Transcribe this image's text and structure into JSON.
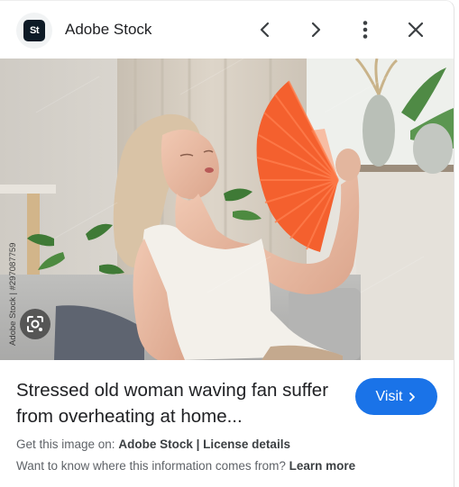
{
  "header": {
    "logo_text": "St",
    "site_name": "Adobe Stock",
    "icons": [
      "chevron-left-icon",
      "chevron-right-icon",
      "more-vert-icon",
      "close-icon"
    ]
  },
  "image": {
    "side_credit": "Adobe Stock | #297087759",
    "lens_icon": "google-lens-icon"
  },
  "result": {
    "title": "Stressed old woman waving fan suffer from overheating at home...",
    "visit_label": "Visit",
    "source_prefix": "Get this image on:",
    "source_name": "Adobe Stock",
    "separator": "|",
    "license_label": "License details",
    "info_question": "Want to know where this information comes from?",
    "learn_more_label": "Learn more"
  },
  "colors": {
    "accent": "#1a73e8",
    "fan": "#f4602e",
    "text": "#202124",
    "muted": "#5f6368"
  }
}
